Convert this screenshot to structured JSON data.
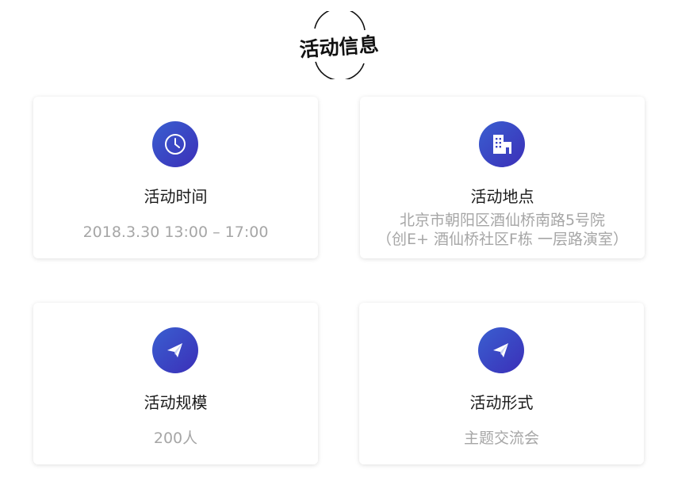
{
  "section": {
    "title": "活动信息"
  },
  "cards": {
    "time": {
      "icon": "clock-icon",
      "label": "活动时间",
      "value": "2018.3.30 13:00 – 17:00"
    },
    "location": {
      "icon": "building-icon",
      "label": "活动地点",
      "value_line1": "北京市朝阳区酒仙桥南路5号院",
      "value_line2": "（创E+ 酒仙桥社区F栋 一层路演室）"
    },
    "scale": {
      "icon": "paper-plane-icon",
      "label": "活动规模",
      "value": "200人"
    },
    "format": {
      "icon": "paper-plane-icon",
      "label": "活动形式",
      "value": "主题交流会"
    }
  },
  "colors": {
    "icon_gradient_start": "#3a5fd0",
    "icon_gradient_end": "#3b2fb8",
    "label": "#1a1a1a",
    "value": "#a6a6a6"
  }
}
